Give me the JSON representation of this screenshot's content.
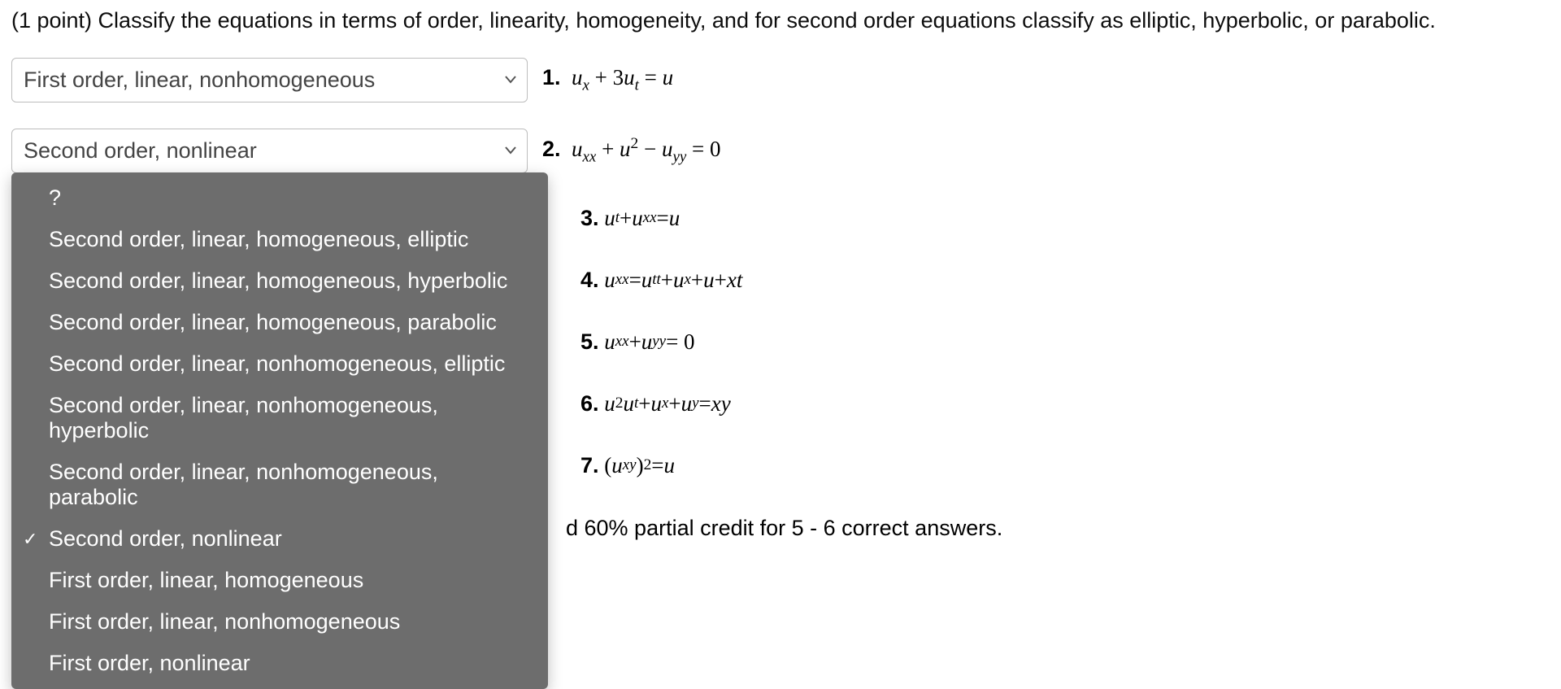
{
  "prompt": "(1 point) Classify the equations in terms of order, linearity, homogeneity, and for second order equations classify as elliptic, hyperbolic, or parabolic.",
  "selects": [
    {
      "value": "First order, linear, nonhomogeneous"
    },
    {
      "value": "Second order, nonlinear"
    }
  ],
  "dropdown_options": [
    "?",
    "Second order, linear, homogeneous, elliptic",
    "Second order, linear, homogeneous, hyperbolic",
    "Second order, linear, homogeneous, parabolic",
    "Second order, linear, nonhomogeneous, elliptic",
    "Second order, linear, nonhomogeneous, hyperbolic",
    "Second order, linear, nonhomogeneous, parabolic",
    "Second order, nonlinear",
    "First order, linear, homogeneous",
    "First order, linear, nonhomogeneous",
    "First order, nonlinear"
  ],
  "dropdown_selected_index": 7,
  "eq_numbers": [
    "1.",
    "2.",
    "3.",
    "4.",
    "5.",
    "6.",
    "7."
  ],
  "partial_credit": "d 60% partial credit for 5 - 6 correct answers."
}
